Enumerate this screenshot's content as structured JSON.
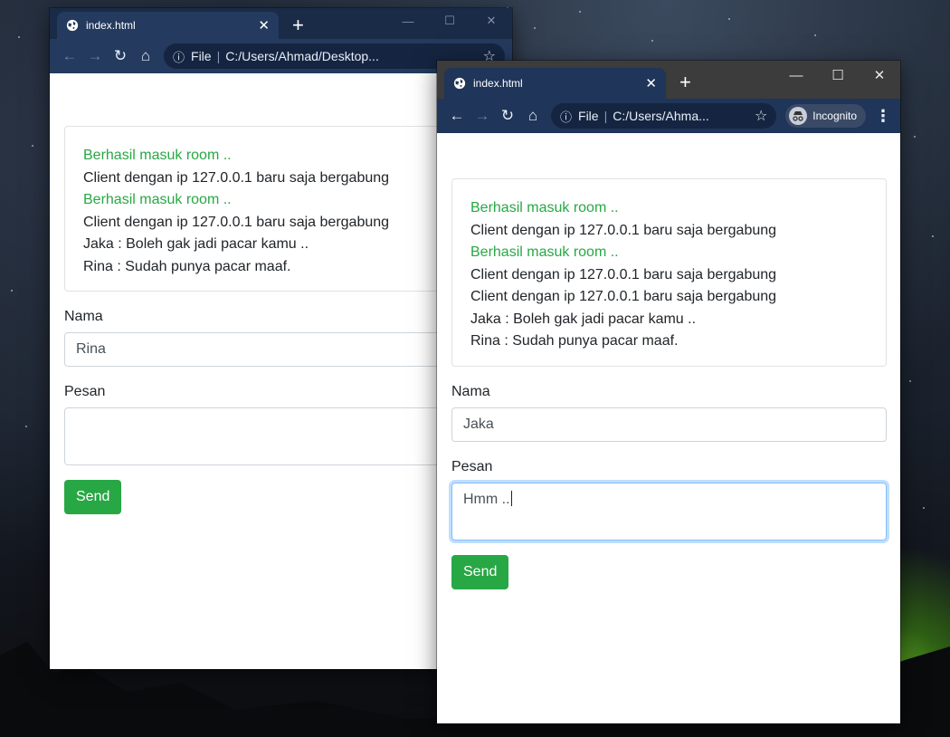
{
  "windows": [
    {
      "tab_title": "index.html",
      "url_scheme": "File",
      "url": "C:/Users/Ahmad/Desktop...",
      "chat": [
        {
          "text": "Berhasil masuk room ..",
          "kind": "system"
        },
        {
          "text": "Client dengan ip 127.0.0.1 baru saja bergabung",
          "kind": "normal"
        },
        {
          "text": "Berhasil masuk room ..",
          "kind": "system"
        },
        {
          "text": "Client dengan ip 127.0.0.1 baru saja bergabung",
          "kind": "normal"
        },
        {
          "text": "Jaka : Boleh gak jadi pacar kamu ..",
          "kind": "normal"
        },
        {
          "text": "Rina : Sudah punya pacar maaf.",
          "kind": "normal"
        }
      ],
      "name_label": "Nama",
      "name_value": "Rina",
      "message_label": "Pesan",
      "message_value": "",
      "send_label": "Send"
    },
    {
      "tab_title": "index.html",
      "url_scheme": "File",
      "url": "C:/Users/Ahma...",
      "incognito_label": "Incognito",
      "chat": [
        {
          "text": "Berhasil masuk room ..",
          "kind": "system"
        },
        {
          "text": "Client dengan ip 127.0.0.1 baru saja bergabung",
          "kind": "normal"
        },
        {
          "text": "Berhasil masuk room ..",
          "kind": "system"
        },
        {
          "text": "Client dengan ip 127.0.0.1 baru saja bergabung",
          "kind": "normal"
        },
        {
          "text": "Client dengan ip 127.0.0.1 baru saja bergabung",
          "kind": "normal"
        },
        {
          "text": "Jaka : Boleh gak jadi pacar kamu ..",
          "kind": "normal"
        },
        {
          "text": "Rina : Sudah punya pacar maaf.",
          "kind": "normal"
        }
      ],
      "name_label": "Nama",
      "name_value": "Jaka",
      "message_label": "Pesan",
      "message_value": "Hmm ..",
      "send_label": "Send"
    }
  ],
  "colors": {
    "system_message": "#28a745",
    "send_button": "#28a745",
    "browser_frame": "#243a5e"
  }
}
